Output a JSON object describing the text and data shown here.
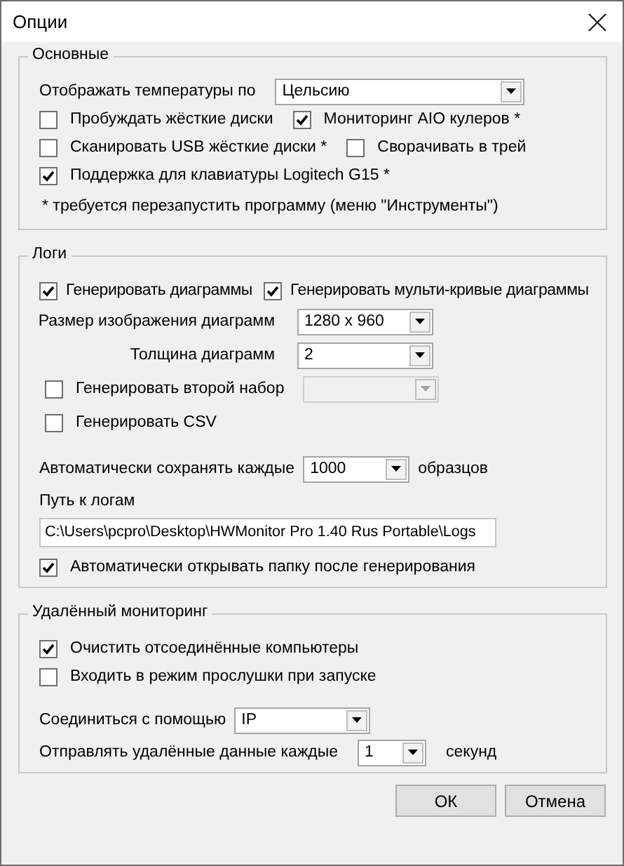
{
  "window": {
    "title": "Опции"
  },
  "groups": [
    {
      "title": "Основные",
      "rows": [
        {
          "kind": "flow",
          "items": [
            {
              "kind": "text",
              "text": "Отображать температуры по"
            },
            {
              "kind": "select",
              "value": "Цельсию",
              "disabled": false
            }
          ]
        },
        {
          "kind": "flow",
          "items": [
            {
              "kind": "checkbox",
              "label": "Пробуждать жёсткие диски",
              "checked": false
            },
            {
              "kind": "checkbox",
              "label": "Мониторинг AIO кулеров *",
              "checked": true
            }
          ]
        },
        {
          "kind": "flow",
          "items": [
            {
              "kind": "checkbox",
              "label": "Сканировать USB жёсткие диски *",
              "checked": false
            },
            {
              "kind": "checkbox",
              "label": "Сворачивать в трей",
              "checked": false
            }
          ]
        },
        {
          "kind": "flow",
          "items": [
            {
              "kind": "checkbox",
              "label": "Поддержка для клавиатуры Logitech G15 *",
              "checked": true
            }
          ]
        },
        {
          "kind": "note",
          "items": [
            {
              "kind": "text",
              "text": "* требуется перезапустить программу (меню \"Инструменты\")"
            }
          ]
        }
      ]
    },
    {
      "title": "Логи",
      "rows": [
        {
          "kind": "flow",
          "items": [
            {
              "kind": "checkbox",
              "label": "Генерировать диаграммы",
              "checked": true
            },
            {
              "kind": "checkbox",
              "label": "Генерировать мульти-кривые диаграммы",
              "checked": true
            }
          ]
        },
        {
          "kind": "grid-right",
          "items": [
            {
              "kind": "text",
              "text": "Размер изображения диаграмм"
            },
            {
              "kind": "select",
              "value": "1280 x 960",
              "disabled": false
            }
          ]
        },
        {
          "kind": "grid-right",
          "items": [
            {
              "kind": "text",
              "text": "Толщина диаграмм"
            },
            {
              "kind": "select",
              "value": "2",
              "disabled": false
            }
          ]
        },
        {
          "kind": "grid-left",
          "items": [
            {
              "kind": "checkbox",
              "label": "Генерировать второй набор",
              "checked": false
            },
            {
              "kind": "select",
              "disabled": true
            }
          ]
        },
        {
          "kind": "grid-left",
          "items": [
            {
              "kind": "checkbox",
              "label": "Генерировать CSV",
              "checked": false
            }
          ]
        },
        {
          "kind": "spaced",
          "items": [
            {
              "kind": "text",
              "text": "Автоматически сохранять каждые"
            },
            {
              "kind": "select",
              "value": "1000",
              "disabled": false
            },
            {
              "kind": "text",
              "text": "образцов"
            }
          ]
        },
        {
          "kind": "flow",
          "items": [
            {
              "kind": "text",
              "text": "Путь к логам"
            }
          ]
        },
        {
          "kind": "flow",
          "items": [
            {
              "kind": "input",
              "value": "C:\\Users\\pcpro\\Desktop\\HWMonitor Pro 1.40 Rus Portable\\Logs"
            }
          ]
        },
        {
          "kind": "flow",
          "items": [
            {
              "kind": "checkbox",
              "label": "Автоматически открывать папку после генерирования",
              "checked": true
            }
          ]
        }
      ]
    },
    {
      "title": "Удалённый мониторинг",
      "rows": [
        {
          "kind": "flow",
          "items": [
            {
              "kind": "checkbox",
              "label": "Очистить отсоединённые компьютеры",
              "checked": true
            }
          ]
        },
        {
          "kind": "flow",
          "items": [
            {
              "kind": "checkbox",
              "label": "Входить в режим прослушки при запуске",
              "checked": false
            }
          ]
        },
        {
          "kind": "spaced",
          "items": [
            {
              "kind": "text",
              "text": "Соединиться с помощью"
            },
            {
              "kind": "select",
              "value": "IP",
              "disabled": false
            }
          ]
        },
        {
          "kind": "flow",
          "items": [
            {
              "kind": "text",
              "text": "Отправлять удалённые данные каждые"
            },
            {
              "kind": "select",
              "value": "1",
              "disabled": false
            },
            {
              "kind": "text",
              "text": "секунд"
            }
          ]
        }
      ]
    }
  ],
  "buttons": [
    {
      "label": "ОК"
    },
    {
      "label": "Отмена"
    }
  ]
}
